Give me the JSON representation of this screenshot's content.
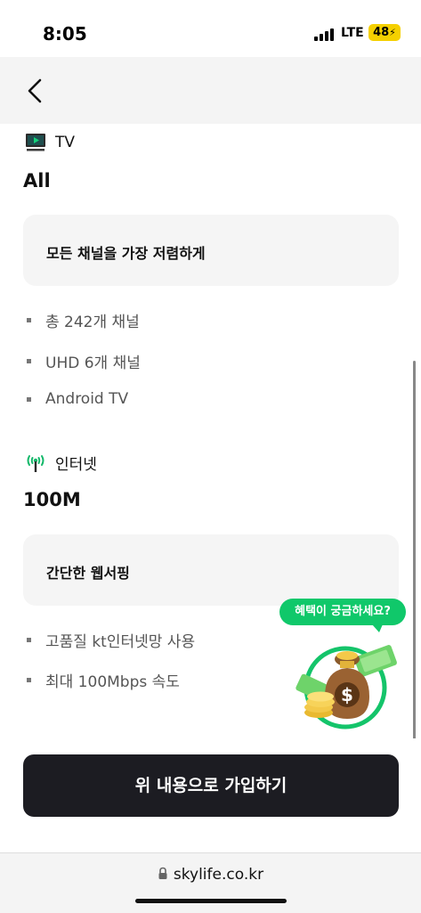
{
  "status": {
    "time": "8:05",
    "network": "LTE",
    "battery": "48"
  },
  "tv": {
    "header": "TV",
    "plan": "All",
    "card_text": "모든 채널을 가장 저렴하게",
    "bullets": [
      "총 242개 채널",
      "UHD 6개 채널",
      "Android TV"
    ]
  },
  "internet": {
    "header": "인터넷",
    "plan": "100M",
    "card_text": "간단한 웹서핑",
    "bullets": [
      "고품질 kt인터넷망 사용",
      "최대 100Mbps 속도"
    ]
  },
  "promo": {
    "bubble": "혜택이 궁금하세요?",
    "money_symbol": "$"
  },
  "cta": {
    "label": "위 내용으로 가입하기"
  },
  "browser": {
    "url": "skylife.co.kr"
  },
  "colors": {
    "accent_green": "#10c86a",
    "cta_bg": "#1c1c22",
    "battery": "#f5d000"
  },
  "icons": {
    "tv": "tv-icon",
    "internet": "antenna-icon",
    "back": "chevron-left-icon",
    "lock": "lock-icon"
  }
}
